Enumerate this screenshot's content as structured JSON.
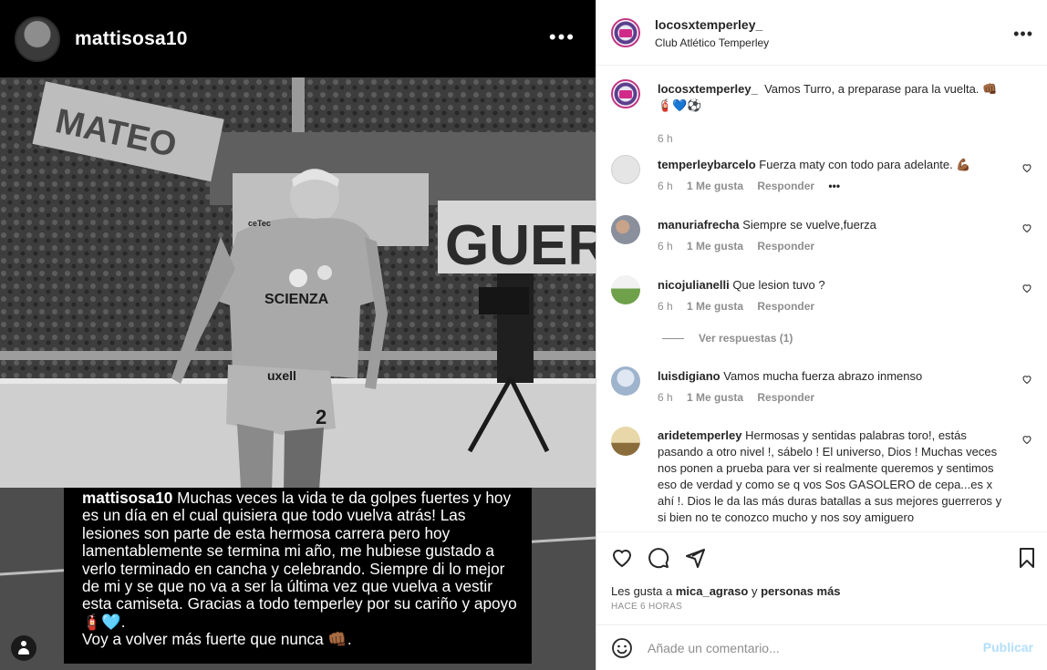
{
  "post": {
    "author": "mattisosa10",
    "caption_user": "mattisosa10",
    "caption_text": "Muchas veces la vida te da golpes fuertes y hoy es un día en el cual quisiera que todo vuelva atrás! Las lesiones son parte de esta hermosa carrera pero hoy lamentablemente se termina mi año, me hubiese gustado a verlo terminado en cancha y celebrando. Siempre di lo mejor de mi y se que no va a ser la última vez que vuelva a vestir esta camiseta. Gracias a todo temperley por su cariño y apoyo 🧯🩵.",
    "caption_line2": "Voy a volver más fuerte que nunca 👊🏾.",
    "photo_text": {
      "banner_left": "MATEO",
      "banner_right": "GUER",
      "jersey_sponsor": "SCIENZA",
      "shorts_sponsor": "uxell",
      "number": "2",
      "collar": "ceTec"
    }
  },
  "panel": {
    "account": "locosxtemperley_",
    "subtitle": "Club Atlético Temperley",
    "main_comment": {
      "user": "locosxtemperley_",
      "text": "Vamos Turro, a preparase para la vuelta. 👊🏾🧯💙⚽",
      "time": "6 h"
    },
    "comments": [
      {
        "user": "temperleybarcelo",
        "text": "Fuerza maty con todo para adelante. 💪🏾",
        "time": "6 h",
        "likes": "1 Me gusta",
        "reply": "Responder",
        "more": "•••"
      },
      {
        "user": "manuriafrecha",
        "text": "Siempre se vuelve,fuerza",
        "time": "6 h",
        "likes": "1 Me gusta",
        "reply": "Responder"
      },
      {
        "user": "nicojulianelli",
        "text": "Que lesion tuvo ?",
        "time": "6 h",
        "likes": "1 Me gusta",
        "reply": "Responder",
        "view_replies": "Ver respuestas (1)"
      },
      {
        "user": "luisdigiano",
        "text": "Vamos mucha fuerza abrazo inmenso",
        "time": "6 h",
        "likes": "1 Me gusta",
        "reply": "Responder"
      },
      {
        "user": "aridetemperley",
        "text": "Hermosas y sentidas palabras toro!, estás pasando a otro nivel !, sábelo ! El universo, Dios ! Muchas veces nos ponen a prueba para ver si realmente queremos y sentimos eso de verdad y como se q vos Sos GASOLERO de cepa...es x ahí !. Dios le da las más duras batallas a sus mejores guerreros y si bien no te conozco mucho y nos soy amiguero"
      }
    ],
    "likes": {
      "prefix": "Les gusta a",
      "user": "mica_agraso",
      "conj": "y",
      "rest": "personas más"
    },
    "posted": "HACE 6 HORAS",
    "comment_placeholder": "Añade un comentario...",
    "publish": "Publicar"
  },
  "icons": {
    "header_more": "more-horizontal-icon",
    "heart": "heart-icon",
    "comment": "comment-icon",
    "share": "send-icon",
    "save": "bookmark-icon",
    "emoji": "smiley-icon",
    "tagged": "person-icon"
  },
  "colors": {
    "link_disabled": "#b2dffc",
    "muted": "#8e8e8e",
    "story_ring": "#c13584"
  }
}
